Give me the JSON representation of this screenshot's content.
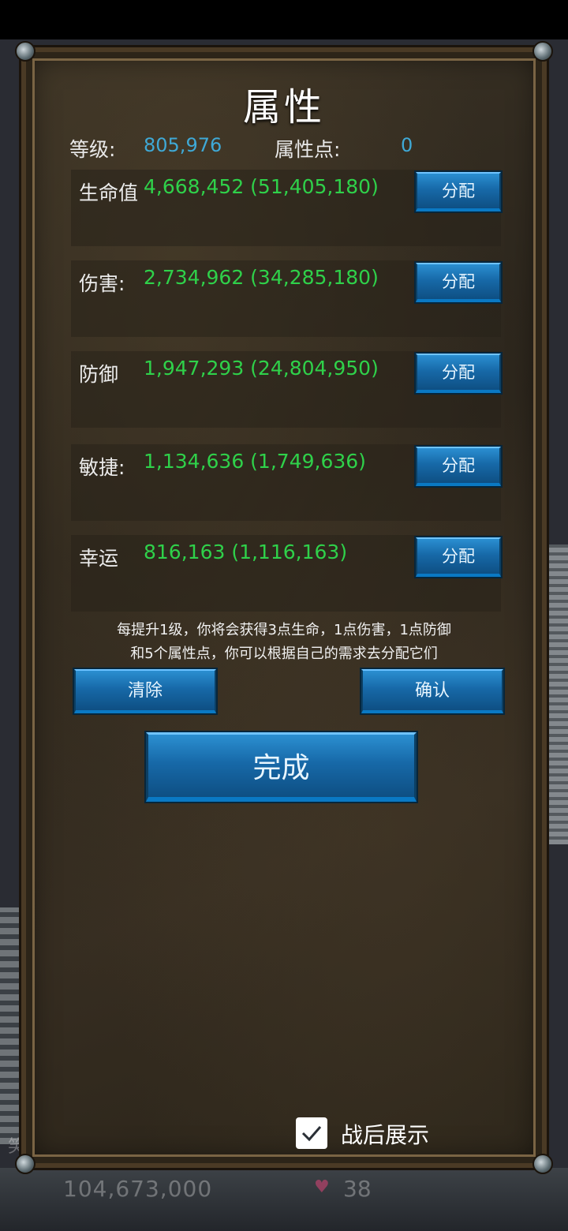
{
  "background": {
    "bottom_value": "104,673,000",
    "bottom_value2": "38",
    "left_glyph": "笑"
  },
  "dialog": {
    "title": "属性",
    "level_label": "等级:",
    "level_value": "805,976",
    "points_label": "属性点:",
    "points_value": "0",
    "stats": [
      {
        "name": "生命值",
        "value": "4,668,452  (51,405,180)",
        "button": "分配"
      },
      {
        "name": "伤害:",
        "value": "2,734,962  (34,285,180)",
        "button": "分配"
      },
      {
        "name": "防御",
        "value": "1,947,293  (24,804,950)",
        "button": "分配"
      },
      {
        "name": "敏捷:",
        "value": "1,134,636  (1,749,636)",
        "button": "分配"
      },
      {
        "name": "幸运",
        "value": "816,163  (1,116,163)",
        "button": "分配"
      }
    ],
    "note_line1": "每提升1级，你将会获得3点生命，1点伤害，1点防御",
    "note_line2": "和5个属性点，你可以根据自己的需求去分配它们",
    "clear_label": "清除",
    "confirm_label": "确认",
    "done_label": "完成",
    "show_after_battle_label": "战后展示",
    "show_after_battle_checked": true
  },
  "colors": {
    "stat_value": "#2fd14a",
    "level_value": "#3fa9d6",
    "button_blue": "#1769a8"
  }
}
